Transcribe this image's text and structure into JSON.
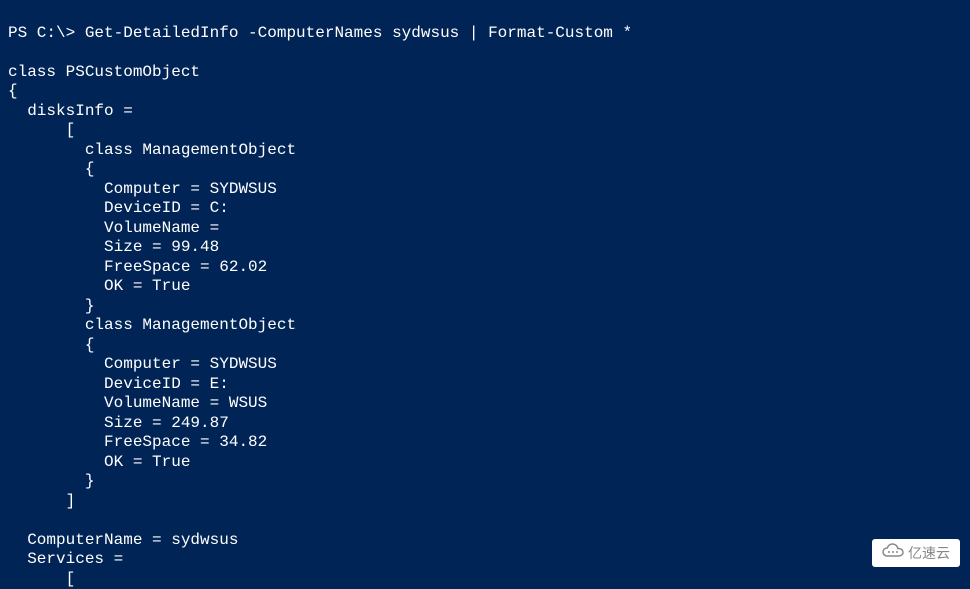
{
  "terminal": {
    "promptPrefix": "PS C:\\> ",
    "command": "Get-DetailedInfo -ComputerNames sydwsus | Format-Custom *",
    "classHeader": "class PSCustomObject",
    "openBrace": "{",
    "disksInfoLabel": "  disksInfo =",
    "arrayOpen": "      [",
    "mgmtObjHeader1": "        class ManagementObject",
    "mgmtObjOpen1": "        {",
    "disk1_computer": "          Computer = SYDWSUS",
    "disk1_deviceId": "          DeviceID = C:",
    "disk1_volumeName": "          VolumeName =",
    "disk1_size": "          Size = 99.48",
    "disk1_freeSpace": "          FreeSpace = 62.02",
    "disk1_ok": "          OK = True",
    "mgmtObjClose1": "        }",
    "mgmtObjHeader2": "        class ManagementObject",
    "mgmtObjOpen2": "        {",
    "disk2_computer": "          Computer = SYDWSUS",
    "disk2_deviceId": "          DeviceID = E:",
    "disk2_volumeName": "          VolumeName = WSUS",
    "disk2_size": "          Size = 249.87",
    "disk2_freeSpace": "          FreeSpace = 34.82",
    "disk2_ok": "          OK = True",
    "mgmtObjClose2": "        }",
    "arrayClose": "      ]",
    "computerNameLine": "  ComputerName = sydwsus",
    "servicesLabel": "  Services =",
    "servicesArrayOpen": "      ["
  },
  "watermark": {
    "text": "亿速云"
  }
}
